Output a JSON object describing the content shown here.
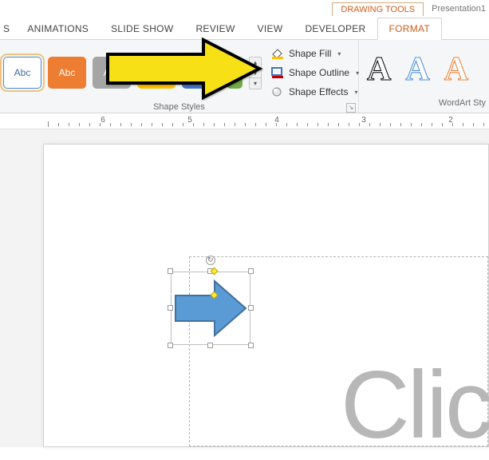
{
  "titlebar": {
    "context_tab": "DRAWING TOOLS",
    "doc_title": "Presentation1"
  },
  "tabs": {
    "items": [
      "S",
      "ANIMATIONS",
      "SLIDE SHOW",
      "REVIEW",
      "VIEW",
      "DEVELOPER",
      "FORMAT"
    ],
    "active_index": 6
  },
  "shape_styles": {
    "group_label": "Shape Styles",
    "tile_label": "Abc",
    "opts": {
      "fill": "Shape Fill",
      "outline": "Shape Outline",
      "effects": "Shape Effects"
    }
  },
  "wordart": {
    "group_label": "WordArt Sty",
    "glyph": "A"
  },
  "ruler": {
    "numbers": [
      "6",
      "5",
      "4",
      "3",
      "2"
    ]
  },
  "placeholder_text": "Clic",
  "colors": {
    "accent_orange": "#ce5c1b",
    "shape_fill": "#5b9bd5",
    "shape_outline": "#41719c",
    "instruct_yellow": "#f7e017"
  }
}
